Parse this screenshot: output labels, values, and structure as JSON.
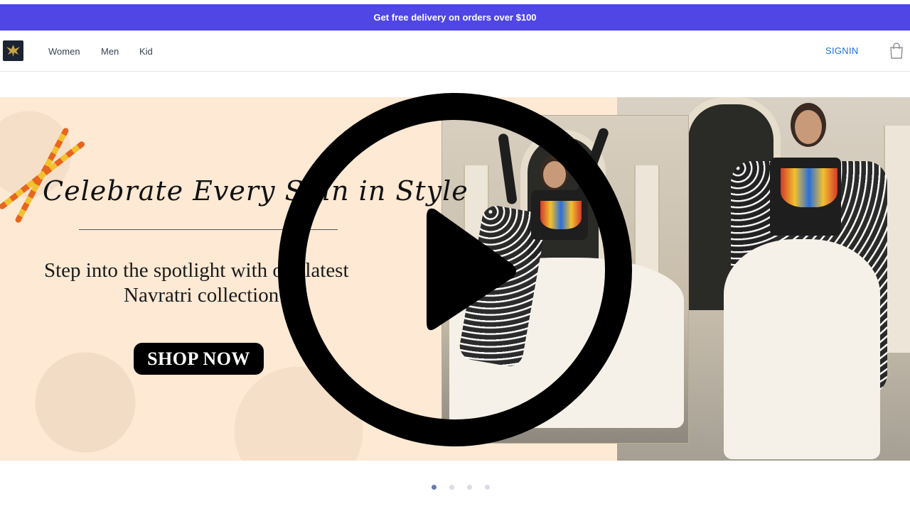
{
  "announcement": {
    "text": "Get free delivery on orders over $100"
  },
  "nav": {
    "links": [
      "Women",
      "Men",
      "Kid"
    ],
    "signin": "SIGNIN"
  },
  "hero": {
    "headline": "Celebrate Every Spin in Style",
    "subtitle_line1": "Step into the spotlight with our latest",
    "subtitle_line2": "Navratri collection",
    "cta": "SHOP NOW"
  },
  "carousel": {
    "slide_count": 4,
    "active_index": 0
  },
  "colors": {
    "announcement_bg": "#4f46e5",
    "signin": "#1d6fd8",
    "active_dot": "#6b79b8",
    "inactive_dot": "#d7dcea"
  },
  "icons": {
    "logo": "eagle-logo-icon",
    "bag": "shopping-bag-icon",
    "play": "play-icon"
  }
}
